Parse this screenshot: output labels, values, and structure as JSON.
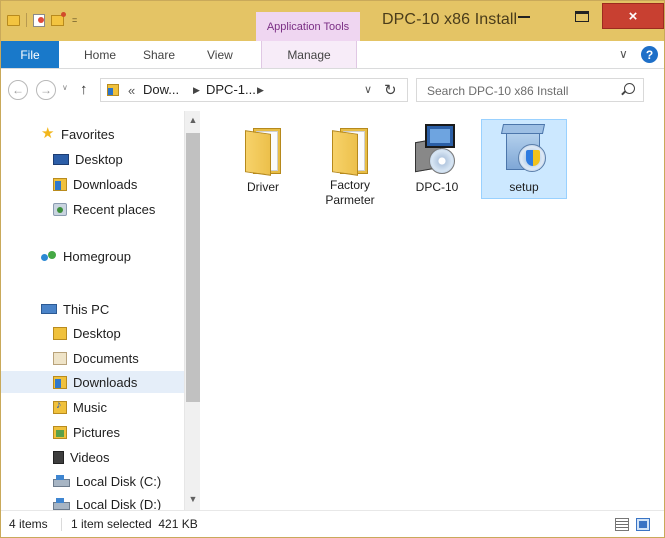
{
  "window": {
    "title": "DPC-10 x86 Install",
    "close_glyph": "×"
  },
  "quick_access_toolbar": {
    "dropdown_glyph": "="
  },
  "contextual_tab": {
    "label": "Application Tools",
    "color": "#efd6f1"
  },
  "ribbon": {
    "tabs": [
      {
        "label": "File"
      },
      {
        "label": "Home"
      },
      {
        "label": "Share"
      },
      {
        "label": "View"
      },
      {
        "label": "Manage"
      }
    ],
    "expand_glyph": "∨",
    "help_glyph": "?"
  },
  "navigation": {
    "back_glyph": "←",
    "forward_glyph": "→",
    "recent_glyph": "∨",
    "up_glyph": "↑"
  },
  "address_bar": {
    "prefix": "«",
    "breadcrumbs": [
      "Dow...",
      "DPC-1..."
    ],
    "separator_glyph": "▶",
    "dropdown_glyph": "∨",
    "refresh_glyph": "↻"
  },
  "search": {
    "placeholder": "Search DPC-10 x86 Install",
    "value": ""
  },
  "nav_pane": {
    "items": [
      {
        "label": "Favorites",
        "icon": "favorites-star-icon"
      },
      {
        "label": "Desktop",
        "icon": "desktop-icon"
      },
      {
        "label": "Downloads",
        "icon": "downloads-folder-icon"
      },
      {
        "label": "Recent places",
        "icon": "recent-places-icon"
      },
      {
        "label": "Homegroup",
        "icon": "homegroup-icon"
      },
      {
        "label": "This PC",
        "icon": "this-pc-icon"
      },
      {
        "label": "Desktop",
        "icon": "desktop-folder-icon"
      },
      {
        "label": "Documents",
        "icon": "documents-folder-icon"
      },
      {
        "label": "Downloads",
        "icon": "downloads-folder-icon",
        "selected": true
      },
      {
        "label": "Music",
        "icon": "music-folder-icon"
      },
      {
        "label": "Pictures",
        "icon": "pictures-folder-icon"
      },
      {
        "label": "Videos",
        "icon": "videos-folder-icon"
      },
      {
        "label": "Local Disk (C:)",
        "icon": "local-disk-icon"
      },
      {
        "label": "Local Disk (D:)",
        "icon": "local-disk-icon"
      }
    ],
    "scroll_up_glyph": "▲",
    "scroll_down_glyph": "▼"
  },
  "files": [
    {
      "label_line1": "Driver",
      "label_line2": "",
      "icon": "folder-icon",
      "selected": false
    },
    {
      "label_line1": "Factory",
      "label_line2": "Parmeter",
      "icon": "folder-icon",
      "selected": false
    },
    {
      "label_line1": "DPC-10",
      "label_line2": "",
      "icon": "installer-exe-icon",
      "selected": false
    },
    {
      "label_line1": "setup",
      "label_line2": "",
      "icon": "setup-installer-icon",
      "selected": true
    }
  ],
  "status_bar": {
    "item_count": "4 items",
    "selection": "1 item selected  421 KB"
  },
  "colors": {
    "titlebar": "#e4c465",
    "file_tab": "#1979ca",
    "close_button": "#c84031",
    "selection": "#cce8ff"
  }
}
